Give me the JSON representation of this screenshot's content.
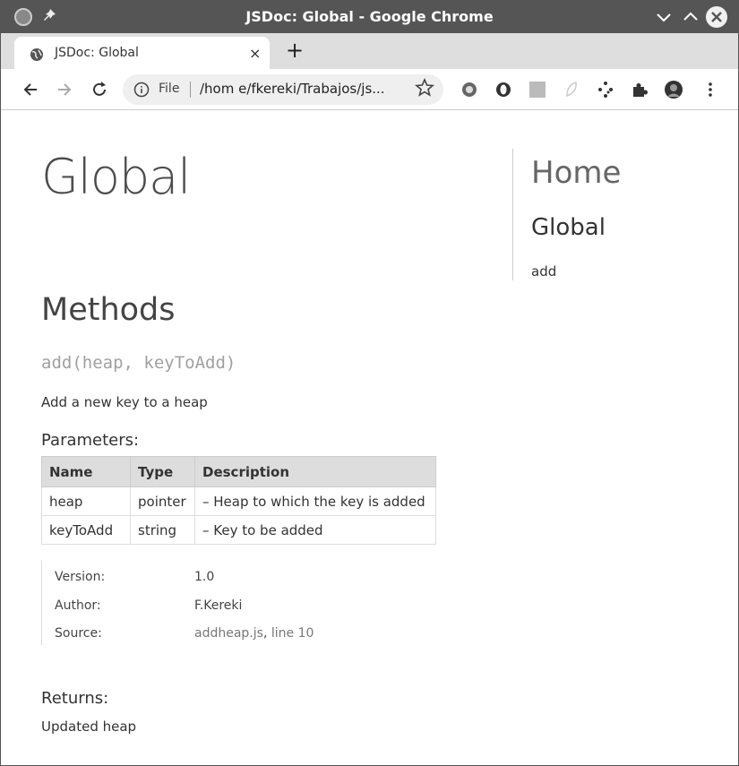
{
  "window": {
    "title": "JSDoc: Global - Google Chrome"
  },
  "tab": {
    "label": "JSDoc: Global",
    "close": "×"
  },
  "newtab": "+",
  "toolbar": {
    "file_label": "File",
    "url": "/hom e/fkereki/Trabajos/js..."
  },
  "icons": {
    "back": "arrow-left-icon",
    "forward": "arrow-right-icon",
    "reload": "reload-icon",
    "star": "star-icon",
    "extensions": "puzzle-icon"
  },
  "page": {
    "title": "Global",
    "methods_heading": "Methods",
    "signature": "add(heap, keyToAdd)",
    "description": "Add a new key to a heap",
    "parameters_heading": "Parameters:",
    "params": {
      "headers": [
        "Name",
        "Type",
        "Description"
      ],
      "rows": [
        [
          "heap",
          "pointer",
          "– Heap to which the key is added"
        ],
        [
          "keyToAdd",
          "string",
          "– Key to be added"
        ]
      ]
    },
    "details": {
      "version_label": "Version:",
      "version": "1.0",
      "author_label": "Author:",
      "author": "F.Kereki",
      "source_label": "Source:",
      "source_file": "addheap.js",
      "source_line": "line 10"
    },
    "returns_heading": "Returns:",
    "returns_text": "Updated heap"
  },
  "nav": {
    "home": "Home",
    "global": "Global",
    "add": "add"
  }
}
